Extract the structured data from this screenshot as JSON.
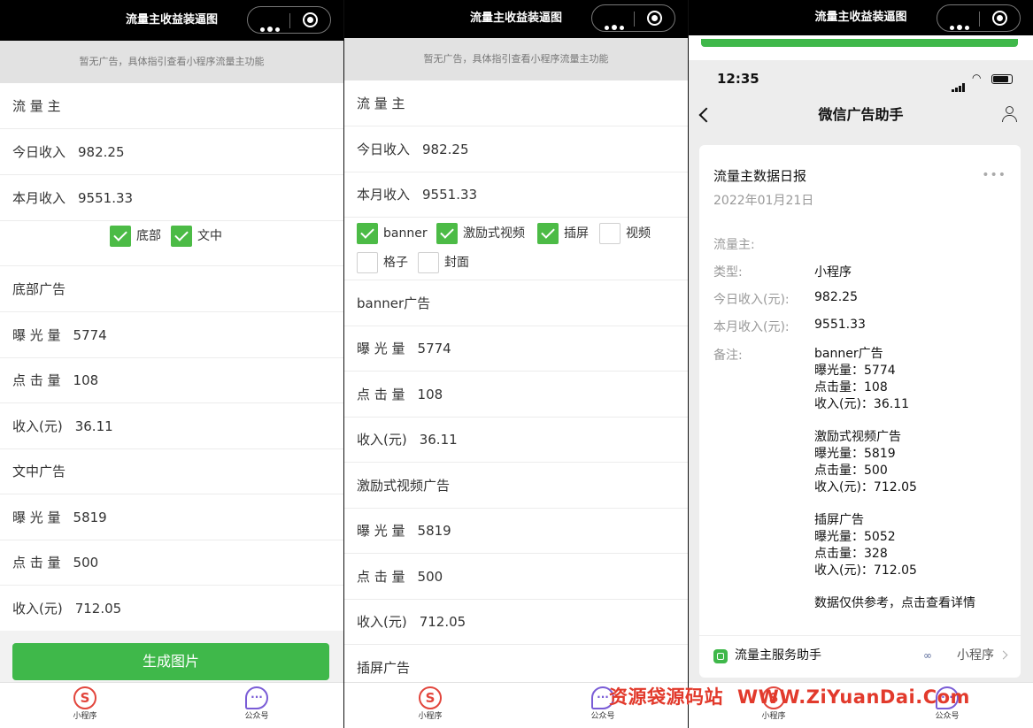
{
  "panel1": {
    "title": "流量主收益装逼图",
    "notice": "暂无广告，具体指引查看小程序流量主功能",
    "rows": [
      {
        "label": "流 量 主",
        "value": ""
      },
      {
        "label": "今日收入",
        "value": "982.25"
      },
      {
        "label": "本月收入",
        "value": "9551.33"
      }
    ],
    "checkboxes": [
      {
        "label": "底部",
        "checked": true
      },
      {
        "label": "文中",
        "checked": true
      }
    ],
    "sections": [
      {
        "title": "底部广告",
        "rows": [
          {
            "label": "曝 光 量",
            "value": "5774"
          },
          {
            "label": "点 击 量",
            "value": "108"
          },
          {
            "label": "收入(元)",
            "value": "36.11"
          }
        ]
      },
      {
        "title": "文中广告",
        "rows": [
          {
            "label": "曝 光 量",
            "value": "5819"
          },
          {
            "label": "点 击 量",
            "value": "500"
          },
          {
            "label": "收入(元)",
            "value": "712.05"
          }
        ]
      }
    ],
    "button": "生成图片",
    "tabs": [
      "小程序",
      "公众号"
    ]
  },
  "panel2": {
    "title": "流量主收益装逼图",
    "notice": "暂无广告，具体指引查看小程序流量主功能",
    "rows": [
      {
        "label": "流 量 主",
        "value": ""
      },
      {
        "label": "今日收入",
        "value": "982.25"
      },
      {
        "label": "本月收入",
        "value": "9551.33"
      }
    ],
    "checkboxes": [
      {
        "label": "banner",
        "checked": true
      },
      {
        "label": "激励式视频",
        "checked": true
      },
      {
        "label": "插屏",
        "checked": true
      },
      {
        "label": "视频",
        "checked": false
      },
      {
        "label": "格子",
        "checked": false
      },
      {
        "label": "封面",
        "checked": false
      }
    ],
    "sections": [
      {
        "title": "banner广告",
        "rows": [
          {
            "label": "曝 光 量",
            "value": "5774"
          },
          {
            "label": "点 击 量",
            "value": "108"
          },
          {
            "label": "收入(元)",
            "value": "36.11"
          }
        ]
      },
      {
        "title": "激励式视频广告",
        "rows": [
          {
            "label": "曝 光 量",
            "value": "5819"
          },
          {
            "label": "点 击 量",
            "value": "500"
          },
          {
            "label": "收入(元)",
            "value": "712.05"
          }
        ]
      },
      {
        "title": "插屏广告",
        "rows": []
      }
    ],
    "tabs": [
      "小程序",
      "公众号"
    ]
  },
  "panel3": {
    "title": "流量主收益装逼图",
    "status_time": "12:35",
    "nav_title": "微信广告助手",
    "card": {
      "title": "流量主数据日报",
      "more": "•••",
      "date": "2022年01月21日",
      "fields": [
        {
          "key": "流量主:",
          "value": ""
        },
        {
          "key": "类型:",
          "value": "小程序"
        },
        {
          "key": "今日收入(元):",
          "value": "982.25"
        },
        {
          "key": "本月收入(元):",
          "value": "9551.33"
        },
        {
          "key": "备注:",
          "value": ""
        }
      ],
      "note_blocks": [
        [
          "banner广告",
          "曝光量：5774",
          "点击量：108",
          "收入(元)：36.11"
        ],
        [
          "激励式视频广告",
          "曝光量：5819",
          "点击量：500",
          "收入(元)：712.05"
        ],
        [
          "插屏广告",
          "曝光量：5052",
          "点击量：328",
          "收入(元)：712.05"
        ],
        [
          "数据仅供参考，点击查看详情"
        ]
      ],
      "footer_left": "流量主服务助手",
      "footer_right": "小程序"
    },
    "tabs": [
      "小程序",
      "公众号"
    ]
  },
  "watermark": {
    "cn": "资源袋源码站",
    "url": "WWW.ZiYuanDai.Com"
  },
  "colors": {
    "accent_green": "#3fb84a",
    "topbar": "#000000",
    "notice_bg": "#e2e2e2",
    "watermark": "#e23a2c"
  }
}
